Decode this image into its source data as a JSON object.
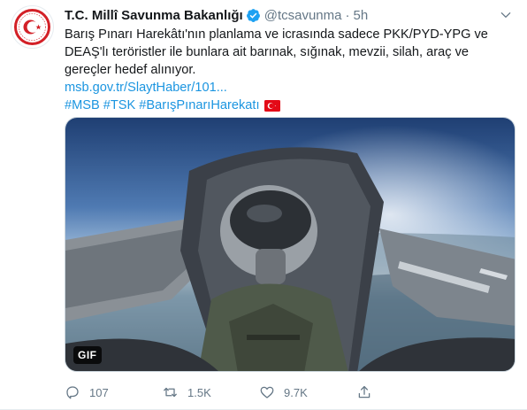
{
  "author": {
    "display_name": "T.C. Millî Savunma Bakanlığı",
    "handle": "@tcsavunma",
    "separator": "·",
    "time": "5h",
    "verified": true
  },
  "tweet": {
    "text": "Barış Pınarı Harekâtı'nın planlama ve icrasında sadece PKK/PYD-YPG ve DEAŞ'lı teröristler ile bunlara ait barınak, sığınak, mevzii, silah, araç ve gereçler hedef alınıyor.",
    "link": "msb.gov.tr/SlaytHaber/101...",
    "hashtags": [
      "#MSB",
      "#TSK",
      "#BarışPınarıHarekatı"
    ]
  },
  "media": {
    "badge": "GIF"
  },
  "actions": {
    "replies": "107",
    "retweets": "1.5K",
    "likes": "9.7K"
  },
  "colors": {
    "link": "#1b95e0",
    "muted": "#657786",
    "verified": "#1da1f2",
    "logo_red": "#d32027"
  },
  "icons": [
    "msb-logo",
    "verified-badge-icon",
    "chevron-down-icon",
    "turkish-flag-icon",
    "reply-icon",
    "retweet-icon",
    "like-icon",
    "share-icon"
  ]
}
